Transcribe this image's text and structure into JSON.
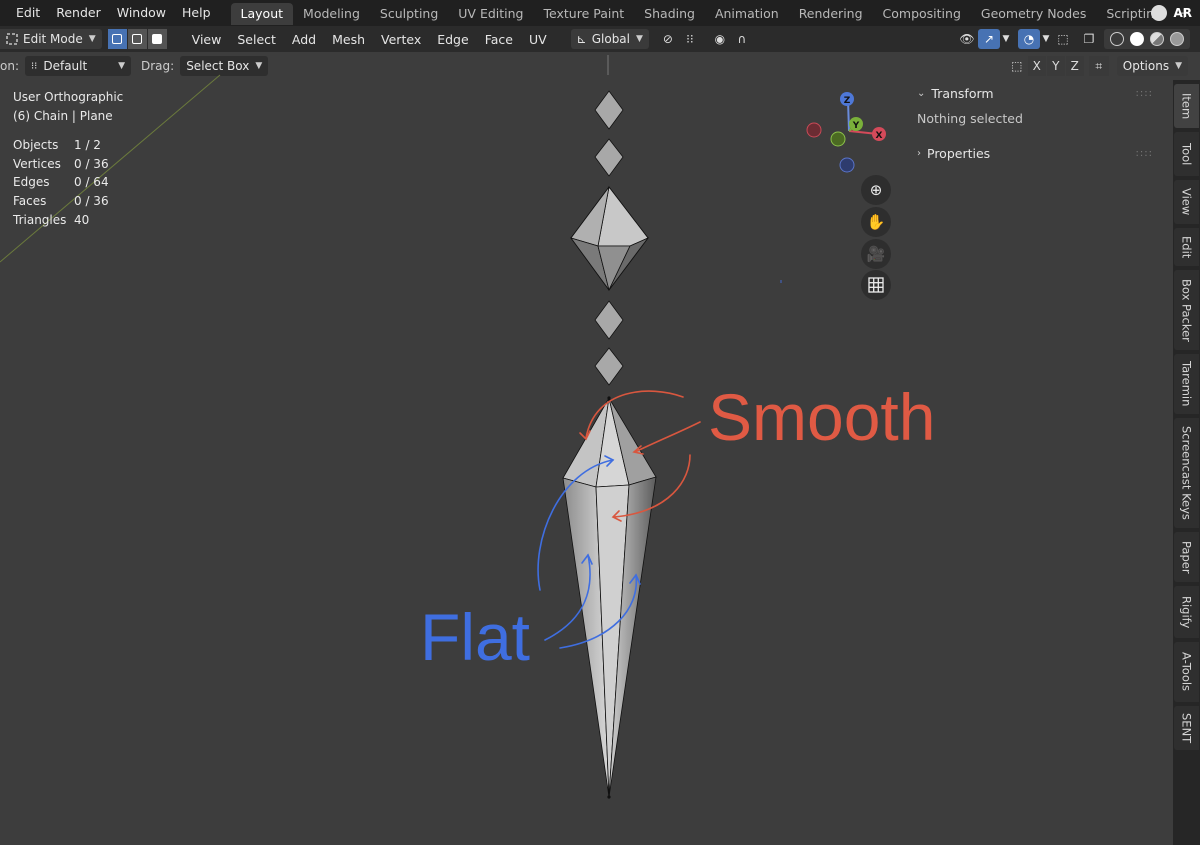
{
  "menubar": {
    "items": [
      "Edit",
      "Render",
      "Window",
      "Help"
    ],
    "workspaces": [
      "Layout",
      "Modeling",
      "Sculpting",
      "UV Editing",
      "Texture Paint",
      "Shading",
      "Animation",
      "Rendering",
      "Compositing",
      "Geometry Nodes",
      "Scripting"
    ],
    "active_workspace": "Layout",
    "add_tab": "+",
    "right_label": "AR"
  },
  "header": {
    "mode": "Edit Mode",
    "menus": [
      "View",
      "Select",
      "Add",
      "Mesh",
      "Vertex",
      "Edge",
      "Face",
      "UV"
    ],
    "orientation": "Global",
    "select_modes": [
      "vertex-select",
      "edge-select",
      "face-select"
    ]
  },
  "toolbar": {
    "orientation_label": "on:",
    "orientation_value": "Default",
    "drag_label": "Drag:",
    "drag_value": "Select Box",
    "axes": [
      "X",
      "Y",
      "Z"
    ],
    "options_label": "Options"
  },
  "viewport": {
    "view_name": "User Orthographic",
    "object_info": "(6) Chain | Plane",
    "stats": [
      {
        "label": "Objects",
        "value": "1 / 2"
      },
      {
        "label": "Vertices",
        "value": "0 / 36"
      },
      {
        "label": "Edges",
        "value": "0 / 64"
      },
      {
        "label": "Faces",
        "value": "0 / 36"
      },
      {
        "label": "Triangles",
        "value": "40"
      }
    ],
    "annotations": {
      "smooth": "Smooth",
      "flat": "Flat"
    },
    "colors": {
      "smooth_annotation": "#e05a44",
      "flat_annotation": "#3f6ee0",
      "background": "#3d3d3d"
    }
  },
  "gizmo": {
    "x": "X",
    "y": "Y",
    "z": "Z"
  },
  "npanel": {
    "transform_title": "Transform",
    "transform_body": "Nothing selected",
    "properties_title": "Properties"
  },
  "tabs": [
    "Item",
    "Tool",
    "View",
    "Edit",
    "Box Packer",
    "Taremin",
    "Screencast Keys",
    "Paper",
    "Rigify",
    "A-Tools",
    "SENT"
  ]
}
